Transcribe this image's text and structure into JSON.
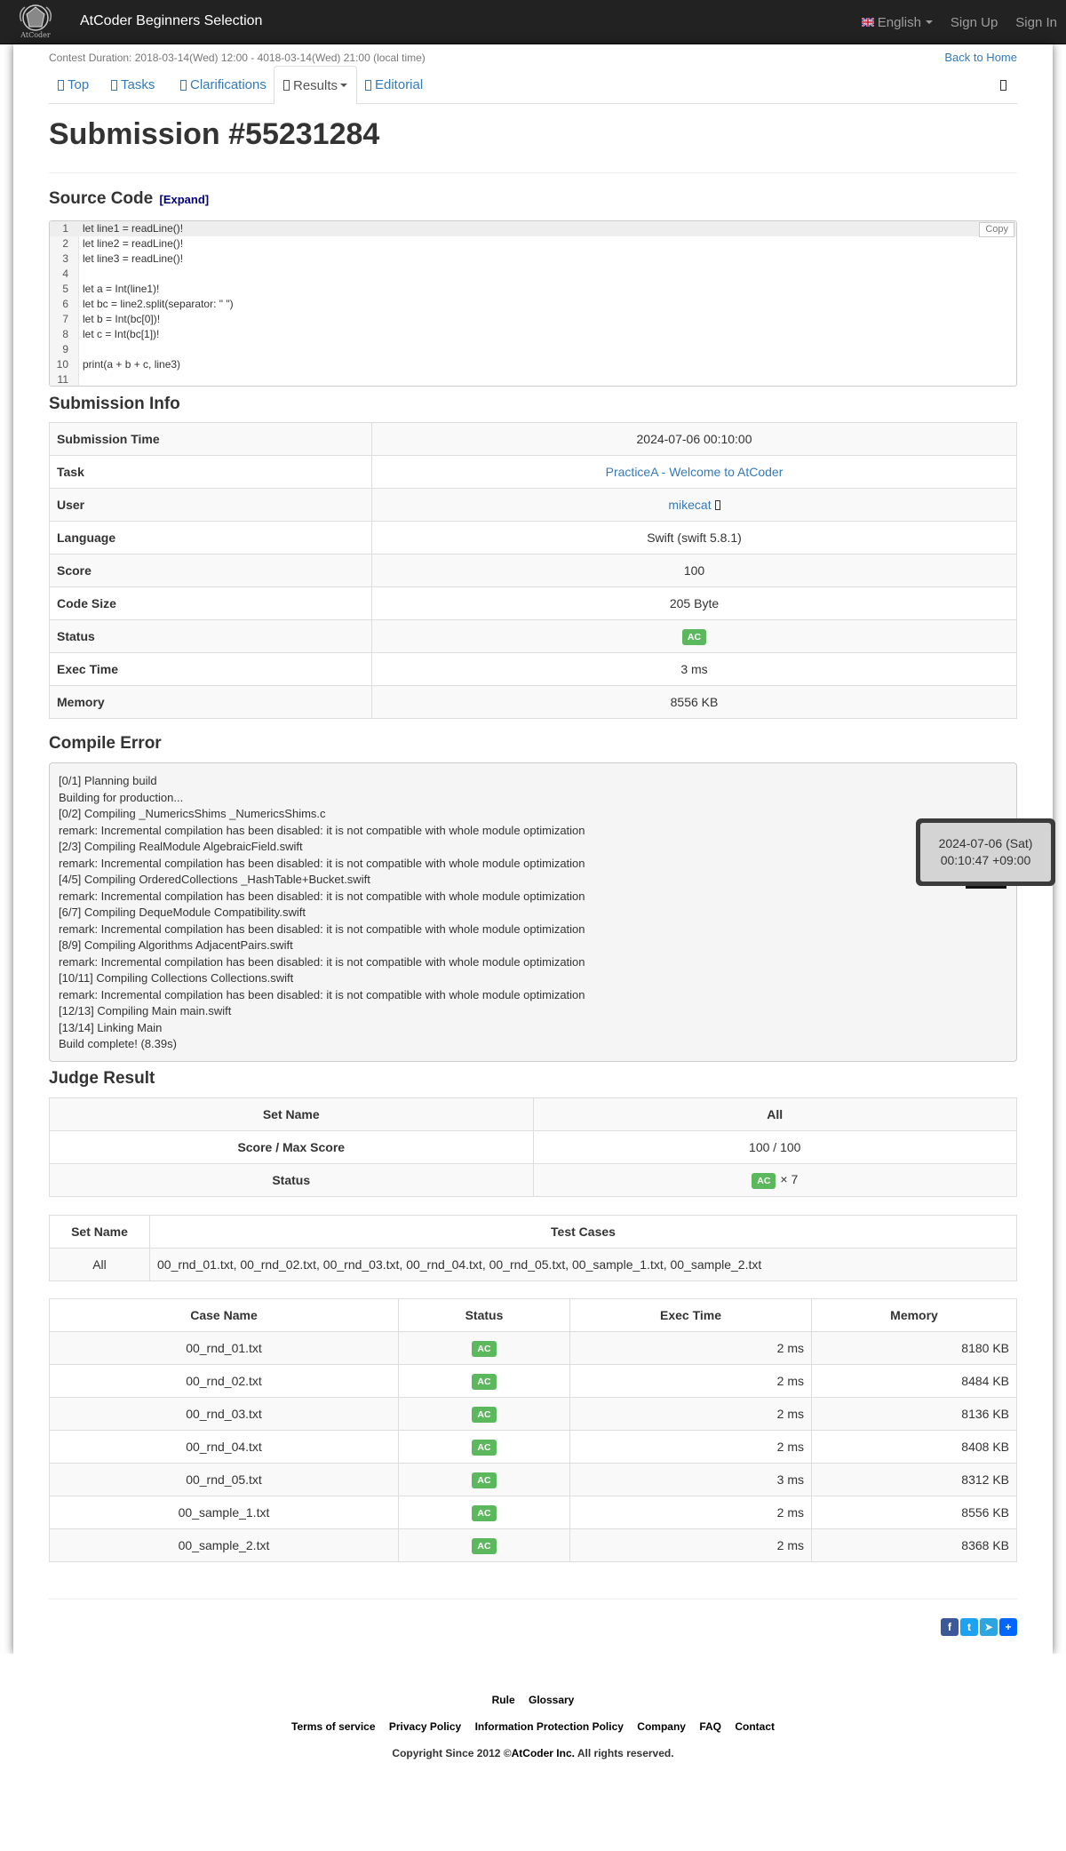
{
  "navbar": {
    "brand": "AtCoder Beginners Selection",
    "logo_text": "AtCoder",
    "language": "English",
    "sign_up": "Sign Up",
    "sign_in": "Sign In"
  },
  "contest": {
    "duration": "Contest Duration: 2018-03-14(Wed) 12:00 - 4018-03-14(Wed) 21:00 (local time)",
    "back_home": "Back to Home"
  },
  "tabs": [
    {
      "label": "Top"
    },
    {
      "label": "Tasks"
    },
    {
      "label": "Clarifications"
    },
    {
      "label": "Results"
    },
    {
      "label": "Editorial"
    }
  ],
  "page_title": "Submission #55231284",
  "source_code": {
    "heading": "Source Code",
    "expand": "[Expand]",
    "copy": "Copy",
    "lines": [
      "let line1 = readLine()!",
      "let line2 = readLine()!",
      "let line3 = readLine()!",
      "",
      "let a = Int(line1)!",
      "let bc = line2.split(separator: \" \")",
      "let b = Int(bc[0])!",
      "let c = Int(bc[1])!",
      "",
      "print(a + b + c, line3)",
      ""
    ],
    "line_numbers": [
      "1",
      "2",
      "3",
      "4",
      "5",
      "6",
      "7",
      "8",
      "9",
      "10",
      "11"
    ]
  },
  "submission_info": {
    "heading": "Submission Info",
    "rows": [
      {
        "label": "Submission Time",
        "value": "2024-07-06 00:10:00"
      },
      {
        "label": "Task",
        "value": "PracticeA - Welcome to AtCoder"
      },
      {
        "label": "User",
        "value": "mikecat"
      },
      {
        "label": "Language",
        "value": "Swift (swift 5.8.1)"
      },
      {
        "label": "Score",
        "value": "100"
      },
      {
        "label": "Code Size",
        "value": "205 Byte"
      },
      {
        "label": "Status",
        "value": "AC"
      },
      {
        "label": "Exec Time",
        "value": "3 ms"
      },
      {
        "label": "Memory",
        "value": "8556 KB"
      }
    ]
  },
  "compile_error": {
    "heading": "Compile Error",
    "lines": [
      "[0/1] Planning build",
      "Building for production...",
      "[0/2] Compiling _NumericsShims _NumericsShims.c",
      "remark: Incremental compilation has been disabled: it is not compatible with whole module optimization",
      "[2/3] Compiling RealModule AlgebraicField.swift",
      "remark: Incremental compilation has been disabled: it is not compatible with whole module optimization",
      "[4/5] Compiling OrderedCollections _HashTable+Bucket.swift",
      "remark: Incremental compilation has been disabled: it is not compatible with whole module optimization",
      "[6/7] Compiling DequeModule Compatibility.swift",
      "remark: Incremental compilation has been disabled: it is not compatible with whole module optimization",
      "[8/9] Compiling Algorithms AdjacentPairs.swift",
      "remark: Incremental compilation has been disabled: it is not compatible with whole module optimization",
      "[10/11] Compiling Collections Collections.swift",
      "remark: Incremental compilation has been disabled: it is not compatible with whole module optimization",
      "[12/13] Compiling Main main.swift",
      "[13/14] Linking Main",
      "Build complete! (8.39s)"
    ]
  },
  "judge_result": {
    "heading": "Judge Result",
    "set_name_label": "Set Name",
    "set_name": "All",
    "score_label": "Score / Max Score",
    "score": "100 / 100",
    "status_label": "Status",
    "status": "AC",
    "count": "× 7"
  },
  "test_sets": {
    "headers": [
      "Set Name",
      "Test Cases"
    ],
    "rows": [
      {
        "set": "All",
        "cases": "00_rnd_01.txt, 00_rnd_02.txt, 00_rnd_03.txt, 00_rnd_04.txt, 00_rnd_05.txt, 00_sample_1.txt, 00_sample_2.txt"
      }
    ]
  },
  "test_cases": {
    "headers": [
      "Case Name",
      "Status",
      "Exec Time",
      "Memory"
    ],
    "rows": [
      {
        "name": "00_rnd_01.txt",
        "status": "AC",
        "time": "2 ms",
        "memory": "8180 KB"
      },
      {
        "name": "00_rnd_02.txt",
        "status": "AC",
        "time": "2 ms",
        "memory": "8484 KB"
      },
      {
        "name": "00_rnd_03.txt",
        "status": "AC",
        "time": "2 ms",
        "memory": "8136 KB"
      },
      {
        "name": "00_rnd_04.txt",
        "status": "AC",
        "time": "2 ms",
        "memory": "8408 KB"
      },
      {
        "name": "00_rnd_05.txt",
        "status": "AC",
        "time": "3 ms",
        "memory": "8312 KB"
      },
      {
        "name": "00_sample_1.txt",
        "status": "AC",
        "time": "2 ms",
        "memory": "8556 KB"
      },
      {
        "name": "00_sample_2.txt",
        "status": "AC",
        "time": "2 ms",
        "memory": "8368 KB"
      }
    ]
  },
  "tooltip": {
    "line1": "2024-07-06 (Sat)",
    "line2": "00:10:47 +09:00"
  },
  "footer": {
    "row1": [
      "Rule",
      "Glossary"
    ],
    "row2": [
      "Terms of service",
      "Privacy Policy",
      "Information Protection Policy",
      "Company",
      "FAQ",
      "Contact"
    ],
    "copyright_prefix": "Copyright Since 2012 ©",
    "copyright_company": "AtCoder Inc.",
    "copyright_suffix": " All rights reserved."
  },
  "share": [
    {
      "icon": "facebook-icon",
      "color": "#3b5998",
      "glyph": "f"
    },
    {
      "icon": "twitter-icon",
      "color": "#1da1f2",
      "glyph": "t"
    },
    {
      "icon": "telegram-icon",
      "color": "#2ca5e0",
      "glyph": "➤"
    },
    {
      "icon": "share-plus-icon",
      "color": "#0166ff",
      "glyph": "+"
    }
  ],
  "colors": {
    "navbar_bg": "#222222",
    "link": "#337ab7",
    "ac_badge": "#5cb85c"
  }
}
